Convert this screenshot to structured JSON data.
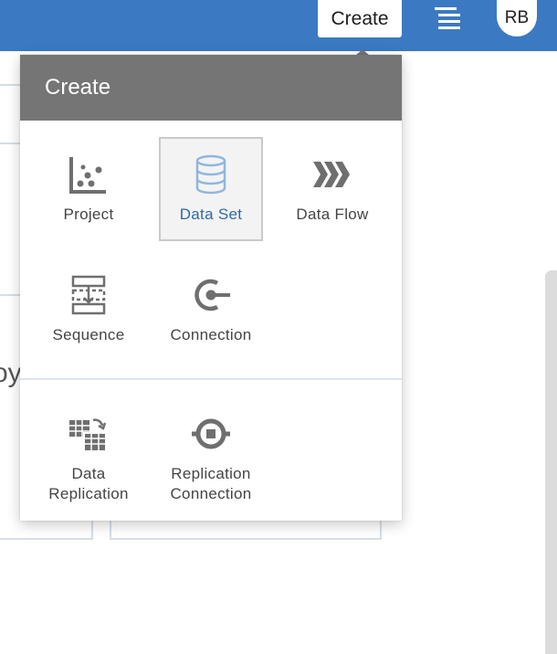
{
  "header": {
    "create_label": "Create",
    "menu_icon": "hamburger-list-icon",
    "avatar_initials": "RB"
  },
  "background": {
    "partial_text": "oy"
  },
  "popover": {
    "title": "Create",
    "items": [
      {
        "label": "Project",
        "icon": "scatter-chart-icon",
        "selected": false
      },
      {
        "label": "Data Set",
        "icon": "database-cylinder-icon",
        "selected": true
      },
      {
        "label": "Data Flow",
        "icon": "chevrons-flow-icon",
        "selected": false
      },
      {
        "label": "Sequence",
        "icon": "sequence-steps-icon",
        "selected": false
      },
      {
        "label": "Connection",
        "icon": "connection-plug-icon",
        "selected": false
      },
      {
        "label": "Data\nReplication",
        "icon": "table-replication-icon",
        "selected": false
      },
      {
        "label": "Replication\nConnection",
        "icon": "replication-target-icon",
        "selected": false
      }
    ]
  },
  "colors": {
    "topbar": "#3b79c2",
    "popover_header": "#757575",
    "selected_label": "#2d6aa8",
    "icon_gray": "#6f6f6f",
    "icon_blue": "#8fb7dd"
  }
}
